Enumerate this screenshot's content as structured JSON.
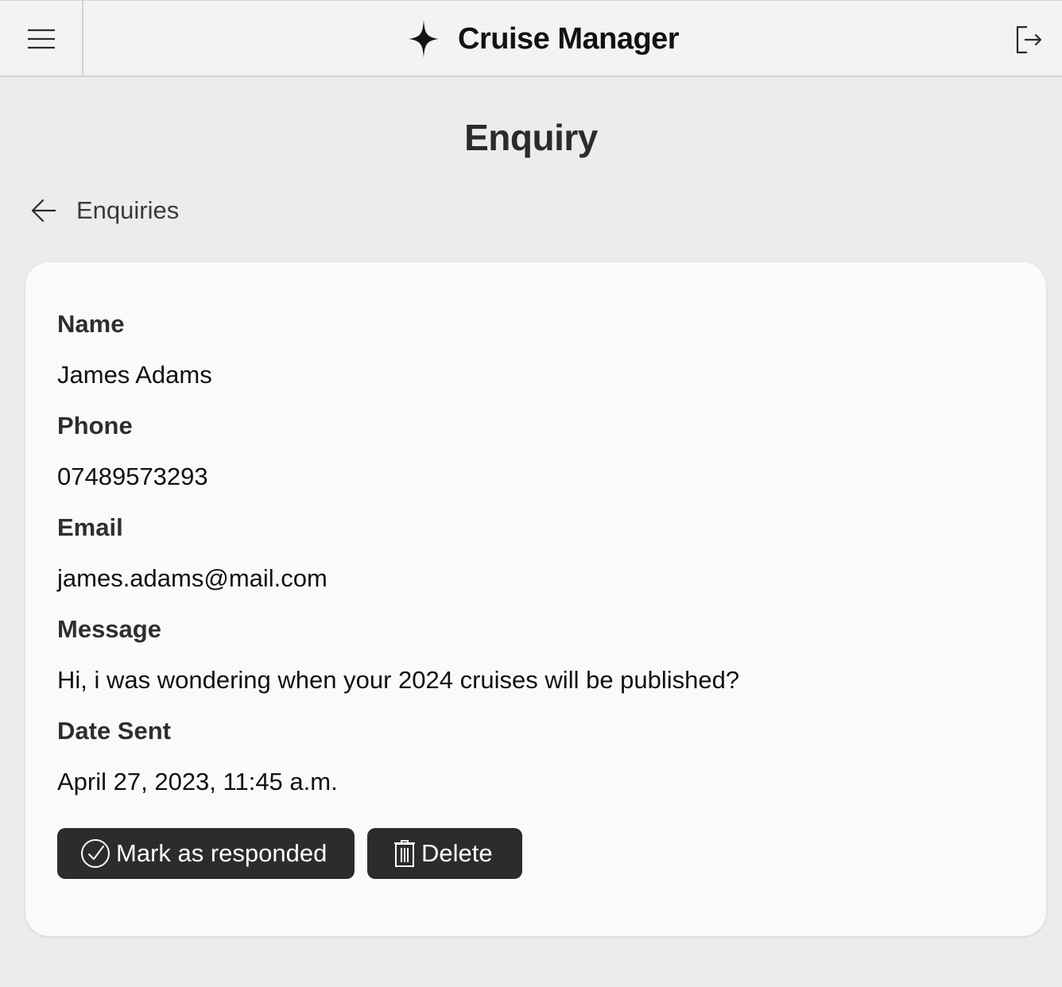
{
  "app": {
    "title": "Cruise Manager",
    "brand_icon": "four-point-star-icon",
    "menu_icon": "hamburger-icon",
    "logout_icon": "logout-icon"
  },
  "page": {
    "title": "Enquiry"
  },
  "back_link": {
    "label": "Enquiries",
    "icon": "arrow-left-icon"
  },
  "enquiry": {
    "fields": [
      {
        "label": "Name",
        "value": "James Adams"
      },
      {
        "label": "Phone",
        "value": "07489573293"
      },
      {
        "label": "Email",
        "value": "james.adams@mail.com"
      },
      {
        "label": "Message",
        "value": "Hi, i was wondering when your 2024 cruises will be published?"
      },
      {
        "label": "Date Sent",
        "value": "April 27, 2023, 11:45 a.m."
      }
    ]
  },
  "actions": {
    "mark_responded": {
      "label": "Mark as responded",
      "icon": "check-circle-icon"
    },
    "delete": {
      "label": "Delete",
      "icon": "trash-icon"
    }
  },
  "colors": {
    "page_background": "#ececec",
    "topbar_background": "#f3f3f3",
    "card_background": "#fafafa",
    "button_background": "#2c2c2c",
    "button_text": "#ffffff"
  }
}
